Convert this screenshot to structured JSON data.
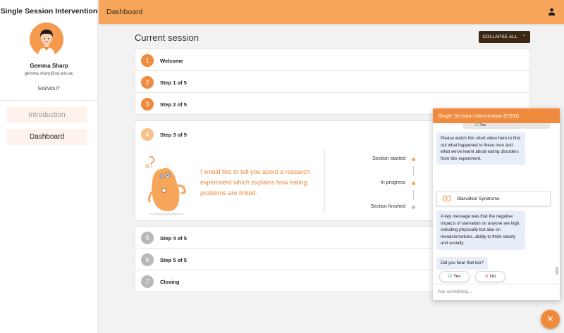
{
  "sidebar": {
    "app_title": "Single Session Intervention",
    "user_name": "Gemma Sharp",
    "user_email": "gemma.sharp@uq.edu.au",
    "signout_label": "SIGNOUT",
    "nav": [
      {
        "label": "Introduction"
      },
      {
        "label": "Dashboard"
      }
    ]
  },
  "header": {
    "title": "Dashboard",
    "user_icon": "person-icon",
    "color": "#f6a55b"
  },
  "main": {
    "title": "Current session",
    "collapse_label": "COLLAPSE ALL",
    "steps": [
      {
        "num": "1",
        "label": "Welcome"
      },
      {
        "num": "2",
        "label": "Step 1 of 5"
      },
      {
        "num": "3",
        "label": "Step 2 of 5"
      },
      {
        "num": "4",
        "label": "Step 3 of 5"
      },
      {
        "num": "5",
        "label": "Step 4 of 5"
      },
      {
        "num": "6",
        "label": "Step 5 of 5"
      },
      {
        "num": "7",
        "label": "Closing"
      }
    ],
    "expanded": {
      "message": "I would like to tell you about a research experiment which explains how eating problems are linked.",
      "timeline": [
        {
          "label": "Section started",
          "state": "done"
        },
        {
          "label": "In progress",
          "state": "current"
        },
        {
          "label": "Section finished",
          "state": "pending"
        }
      ]
    }
  },
  "chat": {
    "title": "Single Session Intervention (ESSI)",
    "prev_answer": "Yes",
    "messages": [
      {
        "text": "Please watch this short video here to find out what happened to these men and what we've learnt about eating disorders from this experiment."
      },
      {
        "text": "A key message was that the negative impacts of starvation on anyone are high, including physically but also on moods/emotions, ability to think clearly and socially."
      },
      {
        "text": "Did you hear that too?"
      }
    ],
    "video_title": "Starvation Syndrome",
    "yes_label": "Yes",
    "no_label": "No",
    "input_placeholder": "Ask something...",
    "fab_icon": "close-icon"
  },
  "colors": {
    "accent": "#f08a3c",
    "dark_button": "#3a2714",
    "bubble": "#e8eef9"
  }
}
